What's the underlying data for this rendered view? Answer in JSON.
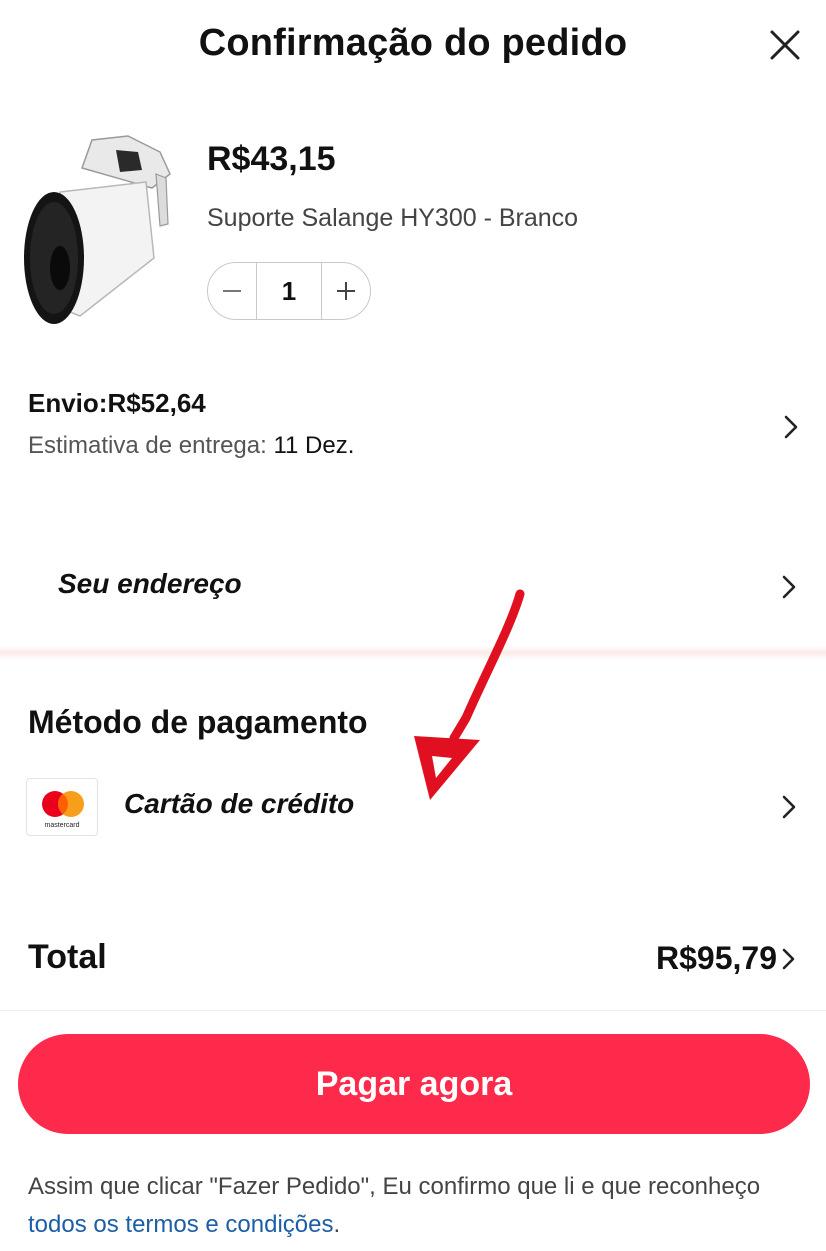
{
  "header": {
    "title": "Confirmação do pedido"
  },
  "product": {
    "price": "R$43,15",
    "name": "Suporte Salange HY300 - Branco",
    "quantity": "1"
  },
  "shipping": {
    "label": "Envio:R$52,64",
    "eta_label": "Estimativa de entrega: ",
    "eta_date": "11 Dez."
  },
  "address": {
    "label": "Seu endereço"
  },
  "payment": {
    "title": "Método de pagamento",
    "method": "Cartão de crédito",
    "card_brand_text": "mastercard"
  },
  "total": {
    "label": "Total",
    "value": "R$95,79"
  },
  "cta": {
    "label": "Pagar agora"
  },
  "legal": {
    "text": "Assim que clicar \"Fazer Pedido\", Eu confirmo que li e que reconheço ",
    "link": "todos os termos e condições",
    "suffix": "."
  },
  "colors": {
    "accent": "#fe2a4b",
    "link": "#1c5fa8",
    "annotation_arrow": "#e01020"
  },
  "icons": [
    "close-icon",
    "minus-icon",
    "plus-icon",
    "chevron-right-icon",
    "mastercard-logo"
  ]
}
